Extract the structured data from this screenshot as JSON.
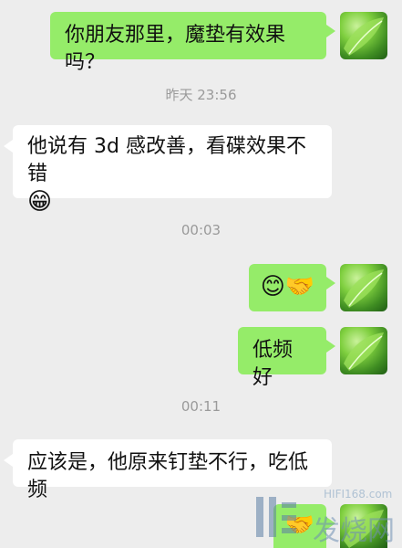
{
  "messages": [
    {
      "side": "out",
      "text": "你朋友那里，魔垫有效果吗？"
    },
    {
      "time": "昨天 23:56"
    },
    {
      "side": "in",
      "text": "他说有 3d 感改善，看碟效果不错",
      "emoji": "😁"
    },
    {
      "time": "00:03"
    },
    {
      "side": "out",
      "emoji": "😊🤝"
    },
    {
      "side": "out",
      "text": "低频好"
    },
    {
      "time": "00:11"
    },
    {
      "side": "in",
      "text": "应该是，他原来钉垫不行，吃低频"
    },
    {
      "side": "out",
      "emoji": "🤝"
    }
  ],
  "watermark": {
    "site": "HIFI168.com",
    "brand": "发烧网"
  },
  "colors": {
    "outgoing_bubble": "#95ec69",
    "incoming_bubble": "#ffffff",
    "background": "#ededed"
  }
}
